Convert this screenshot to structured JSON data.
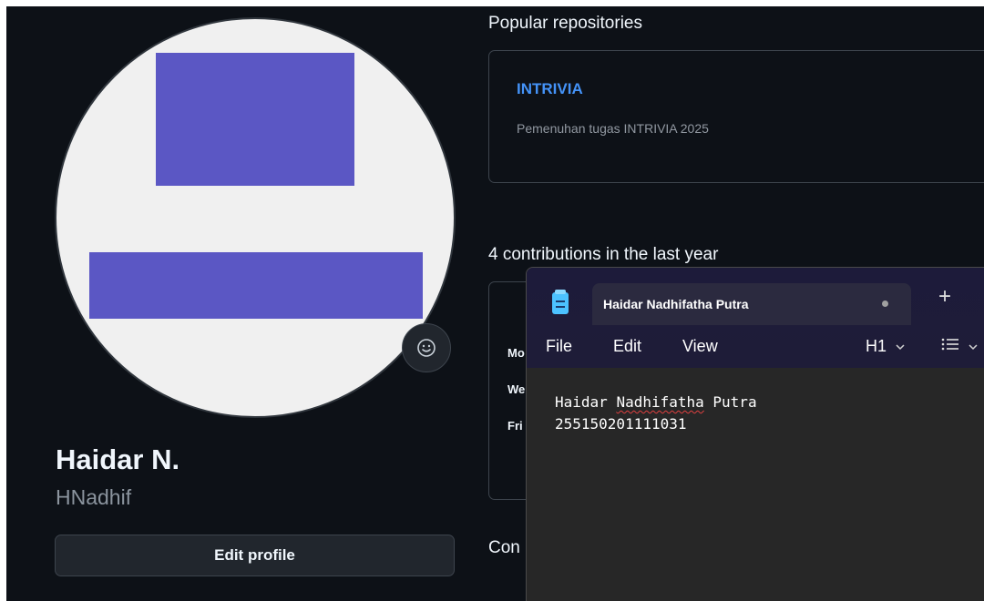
{
  "profile": {
    "name": "Haidar N.",
    "login": "HNadhif",
    "edit_button": "Edit profile",
    "avatar_colors": {
      "background": "#f0f0f0",
      "shapes": "#5b57c4"
    }
  },
  "popular": {
    "title": "Popular repositories",
    "repos": [
      {
        "name": "INTRIVIA",
        "description": "Pemenuhan tugas INTRIVIA 2025"
      }
    ]
  },
  "contributions": {
    "title": "4 contributions in the last year",
    "days": [
      "Mo",
      "We",
      "Fri"
    ],
    "next_section_fragment": "Con"
  },
  "notepad": {
    "tab_title": "Haidar Nadhifatha Putra",
    "menu": [
      "File",
      "Edit",
      "View"
    ],
    "heading_select": "H1",
    "content": {
      "line1_first": "Haidar",
      "line1_misspelled": "Nadhifatha",
      "line1_last": "Putra",
      "line2": "255150201111031"
    },
    "icons": [
      "notepad-icon",
      "unsaved-dot-icon",
      "new-tab-plus-icon",
      "chevron-down-icon",
      "list-icon"
    ]
  },
  "colors": {
    "page_bg": "#0d1117",
    "link_blue": "#4493f8",
    "text_primary": "#f0f6fc",
    "text_muted": "#8b949e",
    "notepad_bg": "#272727"
  }
}
